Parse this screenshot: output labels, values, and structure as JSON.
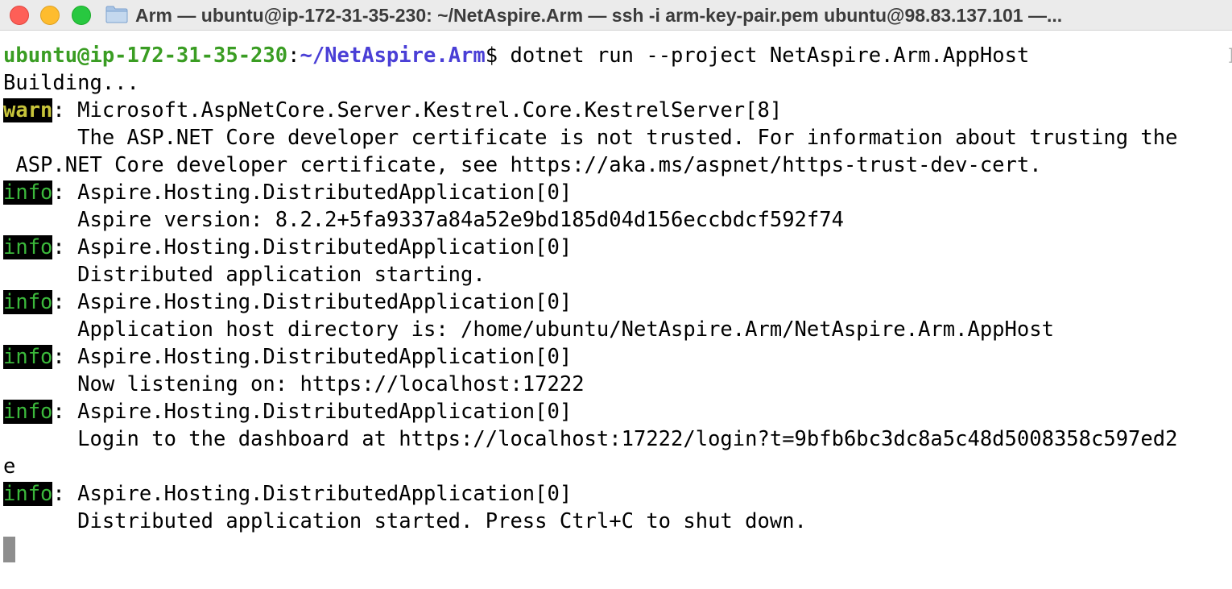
{
  "window": {
    "title": "Arm — ubuntu@ip-172-31-35-230: ~/NetAspire.Arm — ssh -i arm-key-pair.pem ubuntu@98.83.137.101 —..."
  },
  "colors": {
    "prompt_user": "#3a9d23",
    "prompt_path": "#4a3fd6",
    "warn_fg": "#c7c43a",
    "info_fg": "#3bb83b",
    "level_bg": "#000000",
    "close": "#fe5f57",
    "minimize": "#febc2e",
    "zoom": "#28c840"
  },
  "terminal": {
    "prompt": {
      "user_host": "ubuntu@ip-172-31-35-230",
      "separator": ":",
      "path": "~/NetAspire.Arm",
      "symbol": "$",
      "command": " dotnet run --project NetAspire.Arm.AppHost"
    },
    "building": "Building...",
    "entries": [
      {
        "level": "warn",
        "source": ": Microsoft.AspNetCore.Server.Kestrel.Core.KestrelServer[8]",
        "messages": [
          "      The ASP.NET Core developer certificate is not trusted. For information about trusting the",
          " ASP.NET Core developer certificate, see https://aka.ms/aspnet/https-trust-dev-cert."
        ]
      },
      {
        "level": "info",
        "source": ": Aspire.Hosting.DistributedApplication[0]",
        "messages": [
          "      Aspire version: 8.2.2+5fa9337a84a52e9bd185d04d156eccbdcf592f74"
        ]
      },
      {
        "level": "info",
        "source": ": Aspire.Hosting.DistributedApplication[0]",
        "messages": [
          "      Distributed application starting."
        ]
      },
      {
        "level": "info",
        "source": ": Aspire.Hosting.DistributedApplication[0]",
        "messages": [
          "      Application host directory is: /home/ubuntu/NetAspire.Arm/NetAspire.Arm.AppHost"
        ]
      },
      {
        "level": "info",
        "source": ": Aspire.Hosting.DistributedApplication[0]",
        "messages": [
          "      Now listening on: https://localhost:17222"
        ]
      },
      {
        "level": "info",
        "source": ": Aspire.Hosting.DistributedApplication[0]",
        "messages": [
          "      Login to the dashboard at https://localhost:17222/login?t=9bfb6bc3dc8a5c48d5008358c597ed2",
          "e"
        ]
      },
      {
        "level": "info",
        "source": ": Aspire.Hosting.DistributedApplication[0]",
        "messages": [
          "      Distributed application started. Press Ctrl+C to shut down."
        ]
      }
    ]
  },
  "scroll_indicator": "]"
}
